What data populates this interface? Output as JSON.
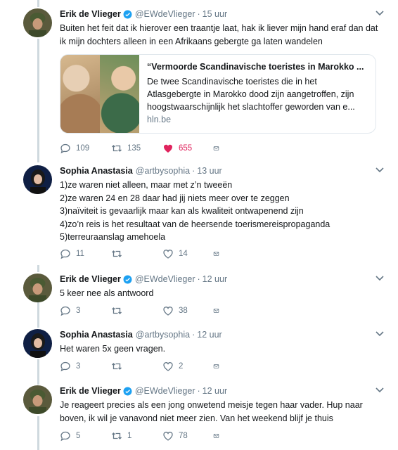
{
  "tweets": [
    {
      "name": "Erik de Vlieger",
      "handle": "@EWdeVlieger",
      "time": "15 uur",
      "text": "Buiten het feit dat ik hierover een traantje laat, hak ik liever mijn hand eraf dan dat ik mijn dochters alleen in een Afrikaans gebergte ga laten wandelen",
      "card": {
        "title": "“Vermoorde Scandinavische toeristes in Marokko ...",
        "description": "De twee Scandinavische toeristes die in het Atlasgebergte in Marokko dood zijn aangetroffen, zijn hoogstwaarschijnlijk het slachtoffer geworden van e...",
        "domain": "hln.be"
      },
      "replies": "109",
      "retweets": "135",
      "likes": "655"
    },
    {
      "name": "Sophia Anastasia",
      "handle": "@artbysophia",
      "time": "13 uur",
      "lines": [
        "1)ze waren niet alleen, maar met z’n tweeën",
        "2)ze waren 24 en 28 daar had jij niets meer over te zeggen",
        "3)naïviteit is gevaarlijk maar kan als kwaliteit ontwapenend zijn",
        "4)zo’n reis is het resultaat van de heersende toerismereispropaganda",
        "5)terreuraanslag amehoela"
      ],
      "replies": "11",
      "retweets": "",
      "likes": "14"
    },
    {
      "name": "Erik de Vlieger",
      "handle": "@EWdeVlieger",
      "time": "12 uur",
      "text": "5 keer nee als antwoord",
      "replies": "3",
      "retweets": "",
      "likes": "38"
    },
    {
      "name": "Sophia Anastasia",
      "handle": "@artbysophia",
      "time": "12 uur",
      "text": "Het waren 5x geen vragen.",
      "replies": "3",
      "retweets": "",
      "likes": "2"
    },
    {
      "name": "Erik de Vlieger",
      "handle": "@EWdeVlieger",
      "time": "12 uur",
      "text": "Je reageert precies als een jong onwetend meisje tegen haar vader. Hup naar boven, ik wil je vanavond niet meer zien. Van het weekend blijf je thuis",
      "replies": "5",
      "retweets": "1",
      "likes": "78"
    }
  ],
  "icons": {
    "verified": "verified-badge-icon",
    "caret": "chevron-down-icon",
    "reply": "reply-icon",
    "retweet": "retweet-icon",
    "like": "heart-icon",
    "dm": "envelope-icon"
  },
  "colors": {
    "accent": "#1da1f2",
    "like": "#e0245e",
    "muted": "#657786",
    "thread": "#cfd9de"
  },
  "separator": "·"
}
